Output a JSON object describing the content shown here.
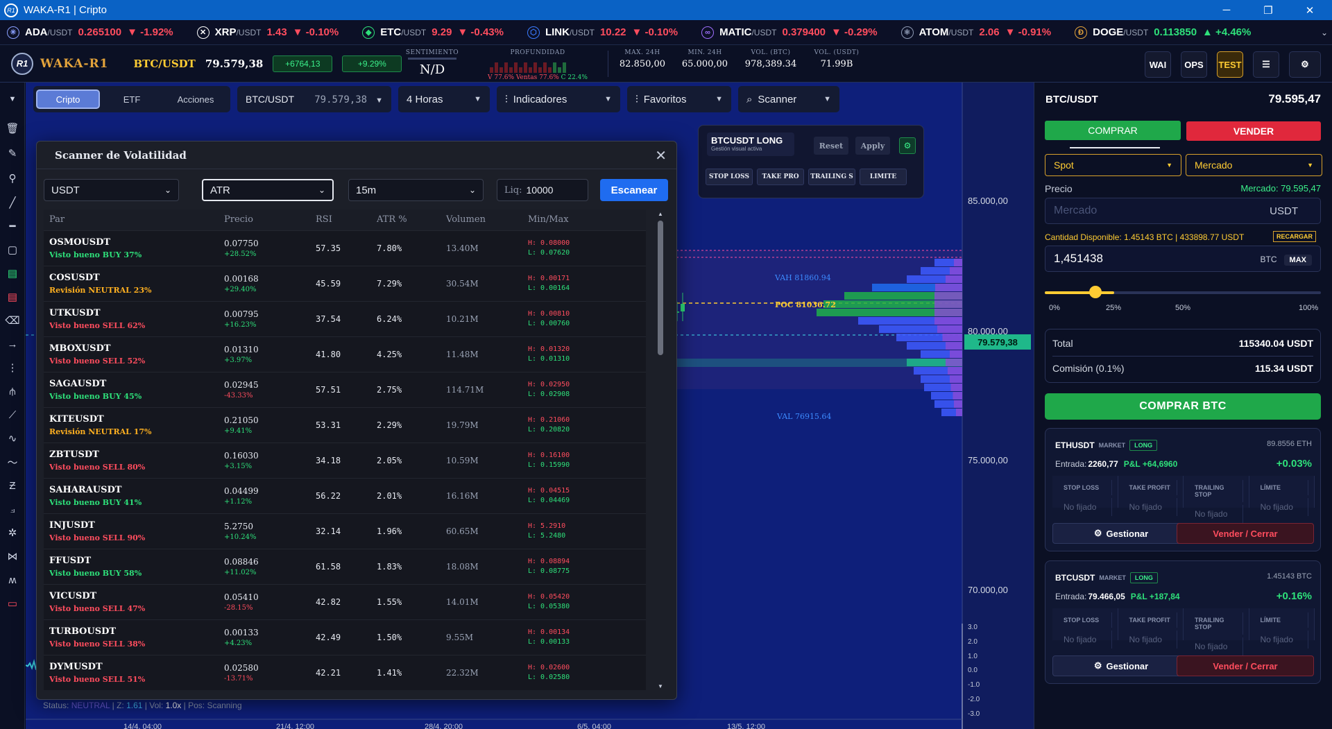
{
  "window": {
    "title": "WAKA-R1 | Cripto",
    "logo_text": "R1"
  },
  "tickers": [
    {
      "sym": "ADA",
      "quote": "/USDT",
      "price": "0.265100",
      "chg": "▼ -1.92%",
      "icon": "ada-coin-icon",
      "glyph": "✳",
      "color": "#8aa0ff"
    },
    {
      "sym": "XRP",
      "quote": "/USDT",
      "price": "1.43",
      "chg": "▼ -0.10%",
      "icon": "xrp-coin-icon",
      "glyph": "✕",
      "color": "#ffffff"
    },
    {
      "sym": "ETC",
      "quote": "/USDT",
      "price": "9.29",
      "chg": "▼ -0.43%",
      "icon": "etc-coin-icon",
      "glyph": "◆",
      "color": "#2ee07a"
    },
    {
      "sym": "LINK",
      "quote": "/USDT",
      "price": "10.22",
      "chg": "▼ -0.10%",
      "icon": "link-coin-icon",
      "glyph": "⬡",
      "color": "#3a7bff"
    },
    {
      "sym": "MATIC",
      "quote": "/USDT",
      "price": "0.379400",
      "chg": "▼ -0.29%",
      "icon": "matic-coin-icon",
      "glyph": "∞",
      "color": "#a070ff"
    },
    {
      "sym": "ATOM",
      "quote": "/USDT",
      "price": "2.06",
      "chg": "▼ -0.91%",
      "icon": "atom-coin-icon",
      "glyph": "⚛",
      "color": "#8f9bb5"
    },
    {
      "sym": "DOGE",
      "quote": "/USDT",
      "price": "0.113850",
      "chg": "▲ +4.46%",
      "icon": "doge-coin-icon",
      "glyph": "Ð",
      "color": "#e3a33b"
    }
  ],
  "header": {
    "brand": "WAKA-R1",
    "pair": "BTC/USDT",
    "price": "79.579,38",
    "change": "+6764,13",
    "change_pct": "+9.29%",
    "sentiment_label": "SENTIMIENTO",
    "sentiment_value": "N/D",
    "depth_label": "PROFUNDIDAD",
    "depth_v": "V 77.6%",
    "depth_ventas": "Ventas 77.6%",
    "depth_c": "C 22.4%",
    "depth_ratio": 0.22,
    "max_label": "MAX. 24H",
    "max_value": "82.850,00",
    "min_label": "MIN. 24H",
    "min_value": "65.000,00",
    "volb_label": "VOL. (BTC)",
    "volb_value": "978,389.34",
    "volu_label": "VOL. (USDT)",
    "volu_value": "71.99B",
    "btn_wai": "WAI",
    "btn_ops": "OPS",
    "btn_test": "TEST"
  },
  "toolbar": {
    "tabs": [
      "Cripto",
      "ETF",
      "Acciones"
    ],
    "active_tab": "Cripto",
    "pair": "BTC/USDT",
    "pair_price": "79.579,38",
    "timeframe": "4 Horas",
    "indicators": "Indicadores",
    "favorites": "Favoritos",
    "scanner": "Scanner"
  },
  "order_widget": {
    "title": "BTCUSDT LONG",
    "subtitle": "Gestión visual activa",
    "reset": "Reset",
    "apply": "Apply",
    "buttons": [
      "STOP LOSS",
      "TAKE PRO",
      "TRAILING S",
      "LIMITE"
    ]
  },
  "chart": {
    "price_labels": [
      "85.000,00",
      "80.000,00",
      "75.000,00",
      "70.000,00"
    ],
    "current_price": "79.579,38",
    "vah": "VAH 81860.94",
    "poc": "POC 81036.72",
    "val": "VAL 76915.64",
    "osc_labels": [
      "3.0",
      "2.0",
      "1.0",
      "0.0",
      "-1.0",
      "-2.0",
      "-3.0"
    ],
    "date_labels": [
      "14/4, 04:00",
      "21/4, 12:00",
      "28/4, 20:00",
      "6/5, 04:00",
      "13/5, 12:00"
    ],
    "status_label": "Status:",
    "status_value": "NEUTRAL",
    "z_label": "| Z:",
    "z_value": "1.61",
    "vol_label": "| Vol:",
    "vol_value": "1.0x",
    "pos_label": "| Pos:",
    "pos_value": "Scanning"
  },
  "scanner": {
    "title": "Scanner de Volatilidad",
    "quote": "USDT",
    "metric": "ATR",
    "interval": "15m",
    "liq_label": "Liq:",
    "liq_value": "10000",
    "scan_button": "Escanear",
    "columns": [
      "Par",
      "Precio",
      "RSI",
      "ATR %",
      "Volumen",
      "Min/Max"
    ],
    "rows": [
      {
        "par": "OSMOUSDT",
        "diag": "Visto bueno BUY 37%",
        "dc": "green",
        "price": "0.07750",
        "chg": "+28.52%",
        "cc": "green",
        "rsi": "57.35",
        "atr": "7.80%",
        "vol": "13.40M",
        "h": "H: 0.08000",
        "l": "L: 0.07620"
      },
      {
        "par": "COSUSDT",
        "diag": "Revisión NEUTRAL 23%",
        "dc": "yellow",
        "price": "0.00168",
        "chg": "+29.40%",
        "cc": "green",
        "rsi": "45.59",
        "atr": "7.29%",
        "vol": "30.54M",
        "h": "H: 0.00171",
        "l": "L: 0.00164"
      },
      {
        "par": "UTKUSDT",
        "diag": "Visto bueno SELL 62%",
        "dc": "red",
        "price": "0.00795",
        "chg": "+16.23%",
        "cc": "green",
        "rsi": "37.54",
        "atr": "6.24%",
        "vol": "10.21M",
        "h": "H: 0.00810",
        "l": "L: 0.00760"
      },
      {
        "par": "MBOXUSDT",
        "diag": "Visto bueno SELL 52%",
        "dc": "red",
        "price": "0.01310",
        "chg": "+3.97%",
        "cc": "green",
        "rsi": "41.80",
        "atr": "4.25%",
        "vol": "11.48M",
        "h": "H: 0.01320",
        "l": "L: 0.01310"
      },
      {
        "par": "SAGAUSDT",
        "diag": "Visto bueno BUY 45%",
        "dc": "green",
        "price": "0.02945",
        "chg": "-43.33%",
        "cc": "red",
        "rsi": "57.51",
        "atr": "2.75%",
        "vol": "114.71M",
        "h": "H: 0.02950",
        "l": "L: 0.02908"
      },
      {
        "par": "KITEUSDT",
        "diag": "Revisión NEUTRAL 17%",
        "dc": "yellow",
        "price": "0.21050",
        "chg": "+9.41%",
        "cc": "green",
        "rsi": "53.31",
        "atr": "2.29%",
        "vol": "19.79M",
        "h": "H: 0.21060",
        "l": "L: 0.20820"
      },
      {
        "par": "ZBTUSDT",
        "diag": "Visto bueno SELL 80%",
        "dc": "red",
        "price": "0.16030",
        "chg": "+3.15%",
        "cc": "green",
        "rsi": "34.18",
        "atr": "2.05%",
        "vol": "10.59M",
        "h": "H: 0.16100",
        "l": "L: 0.15990"
      },
      {
        "par": "SAHARAUSDT",
        "diag": "Visto bueno BUY 41%",
        "dc": "green",
        "price": "0.04499",
        "chg": "+1.12%",
        "cc": "green",
        "rsi": "56.22",
        "atr": "2.01%",
        "vol": "16.16M",
        "h": "H: 0.04515",
        "l": "L: 0.04469"
      },
      {
        "par": "INJUSDT",
        "diag": "Visto bueno SELL 90%",
        "dc": "red",
        "price": "5.2750",
        "chg": "+10.24%",
        "cc": "green",
        "rsi": "32.14",
        "atr": "1.96%",
        "vol": "60.65M",
        "h": "H: 5.2910",
        "l": "L: 5.2480"
      },
      {
        "par": "FFUSDT",
        "diag": "Visto bueno BUY 58%",
        "dc": "green",
        "price": "0.08846",
        "chg": "+11.02%",
        "cc": "green",
        "rsi": "61.58",
        "atr": "1.83%",
        "vol": "18.08M",
        "h": "H: 0.08894",
        "l": "L: 0.08775"
      },
      {
        "par": "VICUSDT",
        "diag": "Visto bueno SELL 47%",
        "dc": "red",
        "price": "0.05410",
        "chg": "-28.15%",
        "cc": "red",
        "rsi": "42.82",
        "atr": "1.55%",
        "vol": "14.01M",
        "h": "H: 0.05420",
        "l": "L: 0.05380"
      },
      {
        "par": "TURBOUSDT",
        "diag": "Visto bueno SELL 38%",
        "dc": "red",
        "price": "0.00133",
        "chg": "+4.23%",
        "cc": "green",
        "rsi": "42.49",
        "atr": "1.50%",
        "vol": "9.55M",
        "h": "H: 0.00134",
        "l": "L: 0.00133"
      },
      {
        "par": "DYMUSDT",
        "diag": "Visto bueno SELL 51%",
        "dc": "red",
        "price": "0.02580",
        "chg": "-13.71%",
        "cc": "red",
        "rsi": "42.21",
        "atr": "1.41%",
        "vol": "22.32M",
        "h": "H: 0.02600",
        "l": "L: 0.02580"
      }
    ]
  },
  "trade": {
    "pair": "BTC/USDT",
    "price": "79.595,47",
    "buy": "COMPRAR",
    "sell": "VENDER",
    "type": "Spot",
    "order": "Mercado",
    "price_label": "Precio",
    "market_label": "Mercado: 79.595,47",
    "price_placeholder": "Mercado",
    "price_unit": "USDT",
    "available": "Cantidad Disponible: 1.45143 BTC | 433898.77 USDT",
    "recharge": "RECARGAR",
    "qty": "1,451438",
    "qty_unit": "BTC",
    "max": "MAX",
    "slider_pct": 25,
    "slider_labels": [
      "0%",
      "25%",
      "50%",
      "100%"
    ],
    "total_label": "Total",
    "total_value": "115340.04 USDT",
    "fee_label": "Comisión (0.1%)",
    "fee_value": "115.34 USDT",
    "buy_btc": "COMPRAR BTC"
  },
  "positions": [
    {
      "sym": "ETHUSDT",
      "mkt": "MARKET",
      "side": "LONG",
      "size": "89.8556 ETH",
      "entry_label": "Entrada:",
      "entry": "2260,77",
      "pnl": "P&L +64,6960",
      "pct": "+0.03%"
    },
    {
      "sym": "BTCUSDT",
      "mkt": "MARKET",
      "side": "LONG",
      "size": "1.45143 BTC",
      "entry_label": "Entrada:",
      "entry": "79.466,05",
      "pnl": "P&L +187,84",
      "pct": "+0.16%"
    }
  ],
  "pos_fields": {
    "sl": "STOP LOSS",
    "tp": "TAKE PROFIT",
    "ts": "TRAILING STOP",
    "lim": "LÍMITE",
    "unset": "No fijado",
    "manage": "Gestionar",
    "close": "Vender / Cerrar"
  }
}
